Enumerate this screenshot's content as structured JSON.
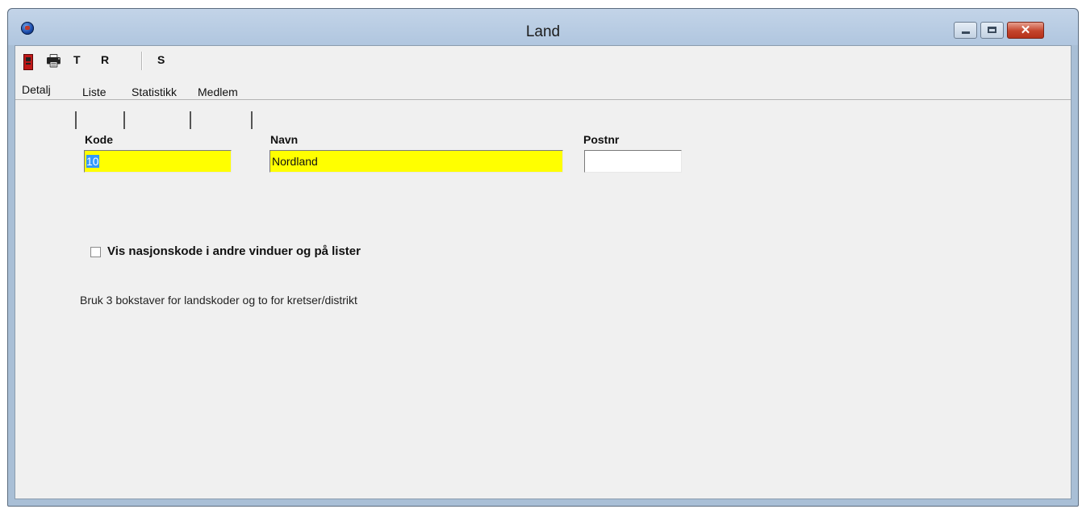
{
  "window": {
    "title": "Land"
  },
  "toolbar": {
    "t_label": "T",
    "r_label": "R",
    "s_label": "S"
  },
  "tabs": [
    {
      "label": "Detalj"
    },
    {
      "label": "Liste"
    },
    {
      "label": "Statistikk"
    },
    {
      "label": "Medlem"
    }
  ],
  "form": {
    "kode": {
      "label": "Kode",
      "value": "10"
    },
    "navn": {
      "label": "Navn",
      "value": "Nordland"
    },
    "postnr": {
      "label": "Postnr",
      "value": ""
    }
  },
  "checkbox": {
    "label": "Vis nasjonskode i andre vinduer og på lister",
    "checked": false
  },
  "hint": "Bruk 3 bokstaver for landskoder og to for kretser/distrikt",
  "colors": {
    "field_highlight": "#ffff00",
    "selection": "#3399ff",
    "background": "#f0f0f0"
  }
}
